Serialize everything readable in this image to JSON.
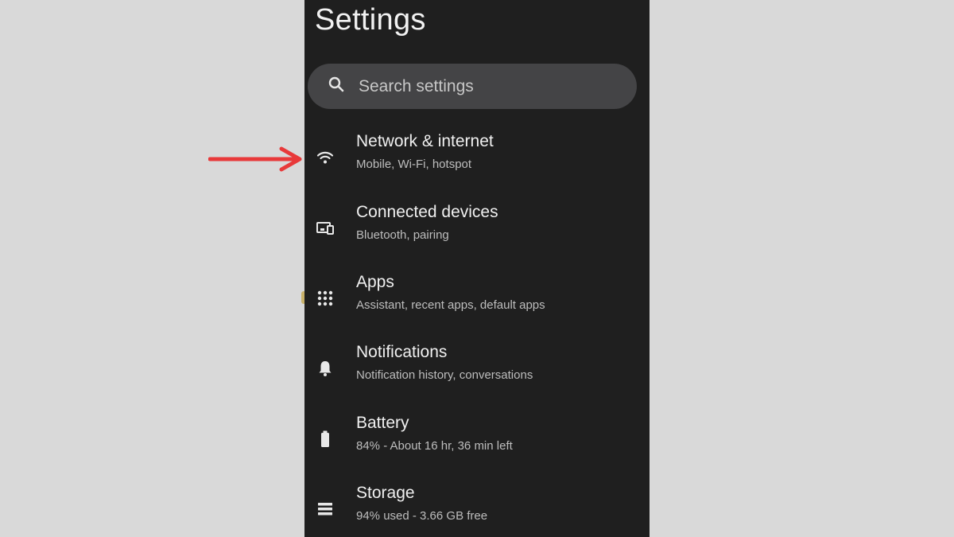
{
  "header": {
    "title": "Settings"
  },
  "search": {
    "placeholder": "Search settings",
    "icon": "search-icon"
  },
  "items": [
    {
      "label": "Network & internet",
      "sub": "Mobile, Wi-Fi, hotspot",
      "icon": "wifi-icon"
    },
    {
      "label": "Connected devices",
      "sub": "Bluetooth, pairing",
      "icon": "connected-devices-icon"
    },
    {
      "label": "Apps",
      "sub": "Assistant, recent apps, default apps",
      "icon": "apps-grid-icon"
    },
    {
      "label": "Notifications",
      "sub": "Notification history, conversations",
      "icon": "bell-icon"
    },
    {
      "label": "Battery",
      "sub": "84% - About 16 hr, 36 min left",
      "icon": "battery-icon"
    },
    {
      "label": "Storage",
      "sub": "94% used - 3.66 GB free",
      "icon": "storage-icon"
    }
  ],
  "annotation": {
    "arrow_color": "#e8393a",
    "points_to": "Network & internet"
  },
  "colors": {
    "background": "#d9d9d9",
    "screen": "#1f1f1f",
    "search_bg": "#444446"
  }
}
